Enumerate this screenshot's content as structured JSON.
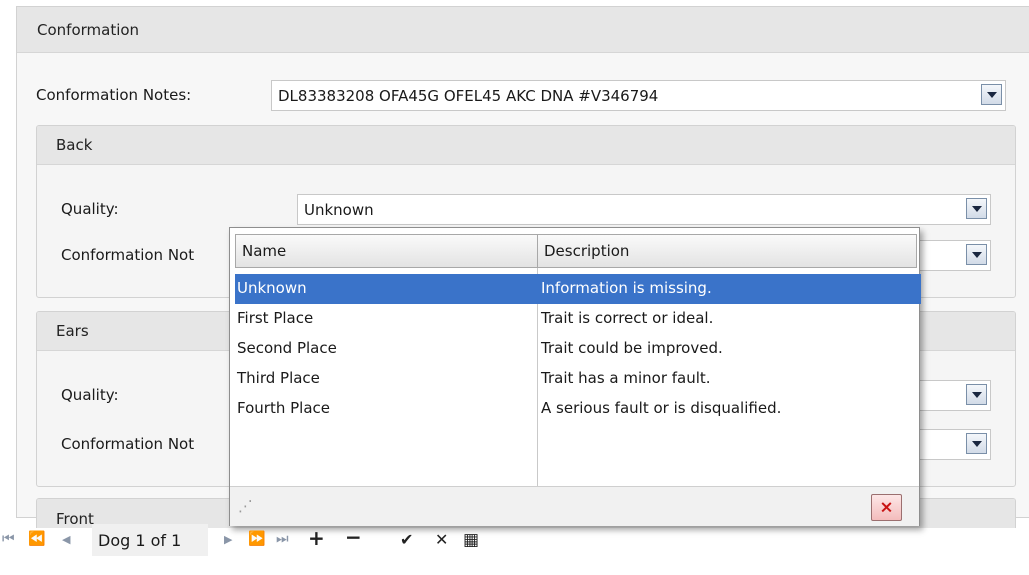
{
  "conformation": {
    "title": "Conformation",
    "notes_label": "Conformation Notes:",
    "notes_value": "DL83383208 OFA45G OFEL45 AKC DNA #V346794"
  },
  "back": {
    "title": "Back",
    "quality_label": "Quality:",
    "quality_value": "Unknown",
    "notes_label": "Conformation Not"
  },
  "ears": {
    "title": "Ears",
    "quality_label": "Quality:",
    "notes_label": "Conformation Not"
  },
  "front": {
    "title": "Front"
  },
  "dropdown": {
    "columns": [
      "Name",
      "Description"
    ],
    "rows": [
      {
        "name": "Unknown",
        "description": "Information is missing.",
        "selected": true
      },
      {
        "name": "First Place",
        "description": "Trait is correct or ideal."
      },
      {
        "name": "Second Place",
        "description": "Trait could be improved."
      },
      {
        "name": "Third Place",
        "description": "Trait has a minor fault."
      },
      {
        "name": "Fourth Place",
        "description": "A serious fault or is disqualified."
      }
    ],
    "close_glyph": "×",
    "resize_glyph": "⋰"
  },
  "navigator": {
    "first": "⏮",
    "prev_page": "⏪",
    "prev": "◀",
    "record_text": "Dog 1 of 1",
    "next": "▶",
    "next_page": "⏩",
    "last": "⏭",
    "add": "+",
    "remove": "−",
    "save": "✔",
    "cancel": "✕",
    "grid": "▦"
  }
}
